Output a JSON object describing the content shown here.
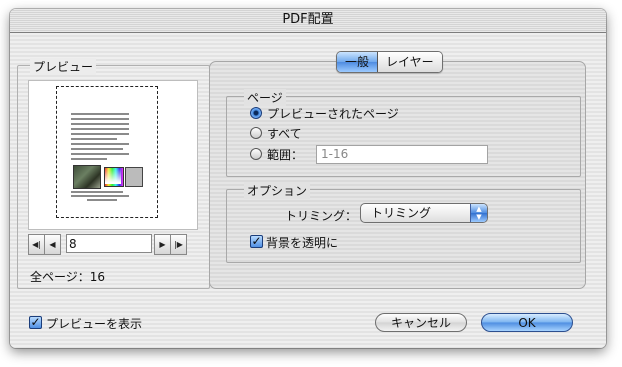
{
  "window": {
    "title": "PDF配置"
  },
  "preview": {
    "group_label": "プレビュー",
    "nav": {
      "first_icon": "first-page-icon",
      "prev_icon": "prev-page-icon",
      "next_icon": "next-page-icon",
      "last_icon": "last-page-icon"
    },
    "current_page": "8",
    "total_pages_label": "全ページ：16"
  },
  "tabs": [
    {
      "label": "一般",
      "selected": true
    },
    {
      "label": "レイヤー",
      "selected": false
    }
  ],
  "page_group": {
    "label": "ページ",
    "options": [
      {
        "label": "プレビューされたページ",
        "selected": true
      },
      {
        "label": "すべて",
        "selected": false
      },
      {
        "label": "範囲：",
        "selected": false
      }
    ],
    "range_value": "1-16"
  },
  "option_group": {
    "label": "オプション",
    "crop_label": "トリミング：",
    "crop_value": "トリミング",
    "transparent_bg_label": "背景を透明に",
    "transparent_bg_checked": true
  },
  "footer": {
    "show_preview_label": "プレビューを表示",
    "show_preview_checked": true,
    "cancel_label": "キャンセル",
    "ok_label": "OK"
  },
  "colors": {
    "accent": "#4d8be0"
  }
}
